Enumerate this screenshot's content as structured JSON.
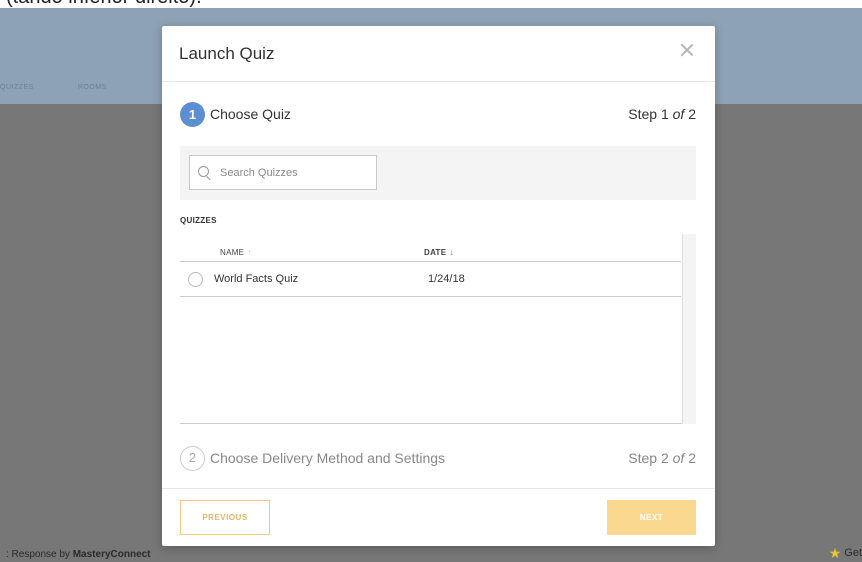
{
  "caption": {
    "text": "(tando inferior direito)."
  },
  "app": {
    "nav": [
      "QUIZZES",
      "ROOMS"
    ],
    "footer_left_prefix": ": Response by ",
    "footer_left_brand": "MasteryConnect",
    "footer_right": "Get"
  },
  "modal": {
    "title": "Launch Quiz",
    "step1": {
      "number": "1",
      "label": "Choose Quiz",
      "count_prefix": "Step 1 ",
      "count_of": "of",
      "count_suffix": " 2"
    },
    "search": {
      "placeholder": "Search Quizzes"
    },
    "section_label": "QUIZZES",
    "table": {
      "columns": {
        "name": "NAME",
        "date": "DATE"
      },
      "rows": [
        {
          "name": "World Facts Quiz",
          "date": "1/24/18"
        }
      ]
    },
    "step2": {
      "number": "2",
      "label": "Choose Delivery Method and Settings",
      "count_prefix": "Step 2 ",
      "count_of": "of",
      "count_suffix": " 2"
    },
    "footer": {
      "previous": "PREVIOUS",
      "next": "NEXT"
    }
  },
  "colors": {
    "header": "#8ea2b5",
    "accent_blue": "#5c8fd1",
    "button_gold": "#fbd88f"
  },
  "icons": {
    "close": "close-icon",
    "search": "search-icon",
    "sort_up": "arrow-up-icon",
    "sort_down": "arrow-down-icon",
    "star": "star-icon"
  }
}
